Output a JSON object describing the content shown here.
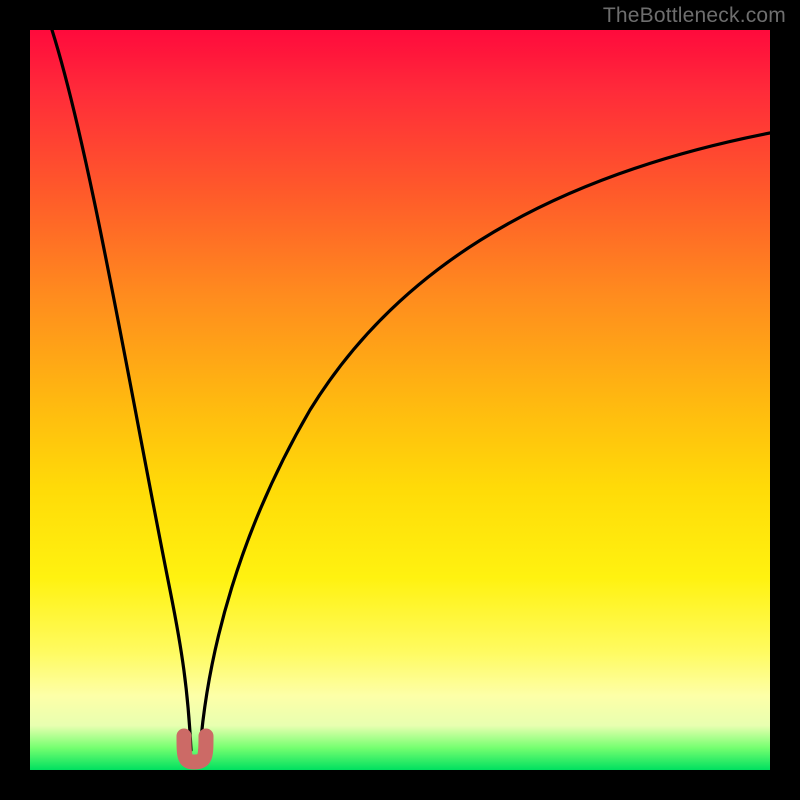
{
  "watermark": {
    "text": "TheBottleneck.com"
  },
  "chart_data": {
    "type": "line",
    "title": "",
    "xlabel": "",
    "ylabel": "",
    "xlim": [
      0,
      100
    ],
    "ylim": [
      0,
      100
    ],
    "background_gradient_meaning": "red (top) = bad / high bottleneck, green (bottom) = good / no bottleneck",
    "minimum_marker": {
      "x": 22,
      "y": 1,
      "color": "#cc6a66",
      "shape": "U"
    },
    "series": [
      {
        "name": "curve-left",
        "x": [
          3,
          5,
          7,
          9,
          11,
          13,
          15,
          17,
          18.5,
          20,
          21,
          21.8
        ],
        "values": [
          100,
          90,
          79,
          68,
          57,
          46,
          35,
          24,
          15,
          8,
          3,
          1
        ]
      },
      {
        "name": "curve-right",
        "x": [
          22.5,
          24,
          26,
          29,
          33,
          38,
          44,
          52,
          62,
          74,
          86,
          100
        ],
        "values": [
          1,
          5,
          12,
          21,
          32,
          43,
          53,
          62,
          70,
          77,
          82,
          86
        ]
      }
    ]
  }
}
